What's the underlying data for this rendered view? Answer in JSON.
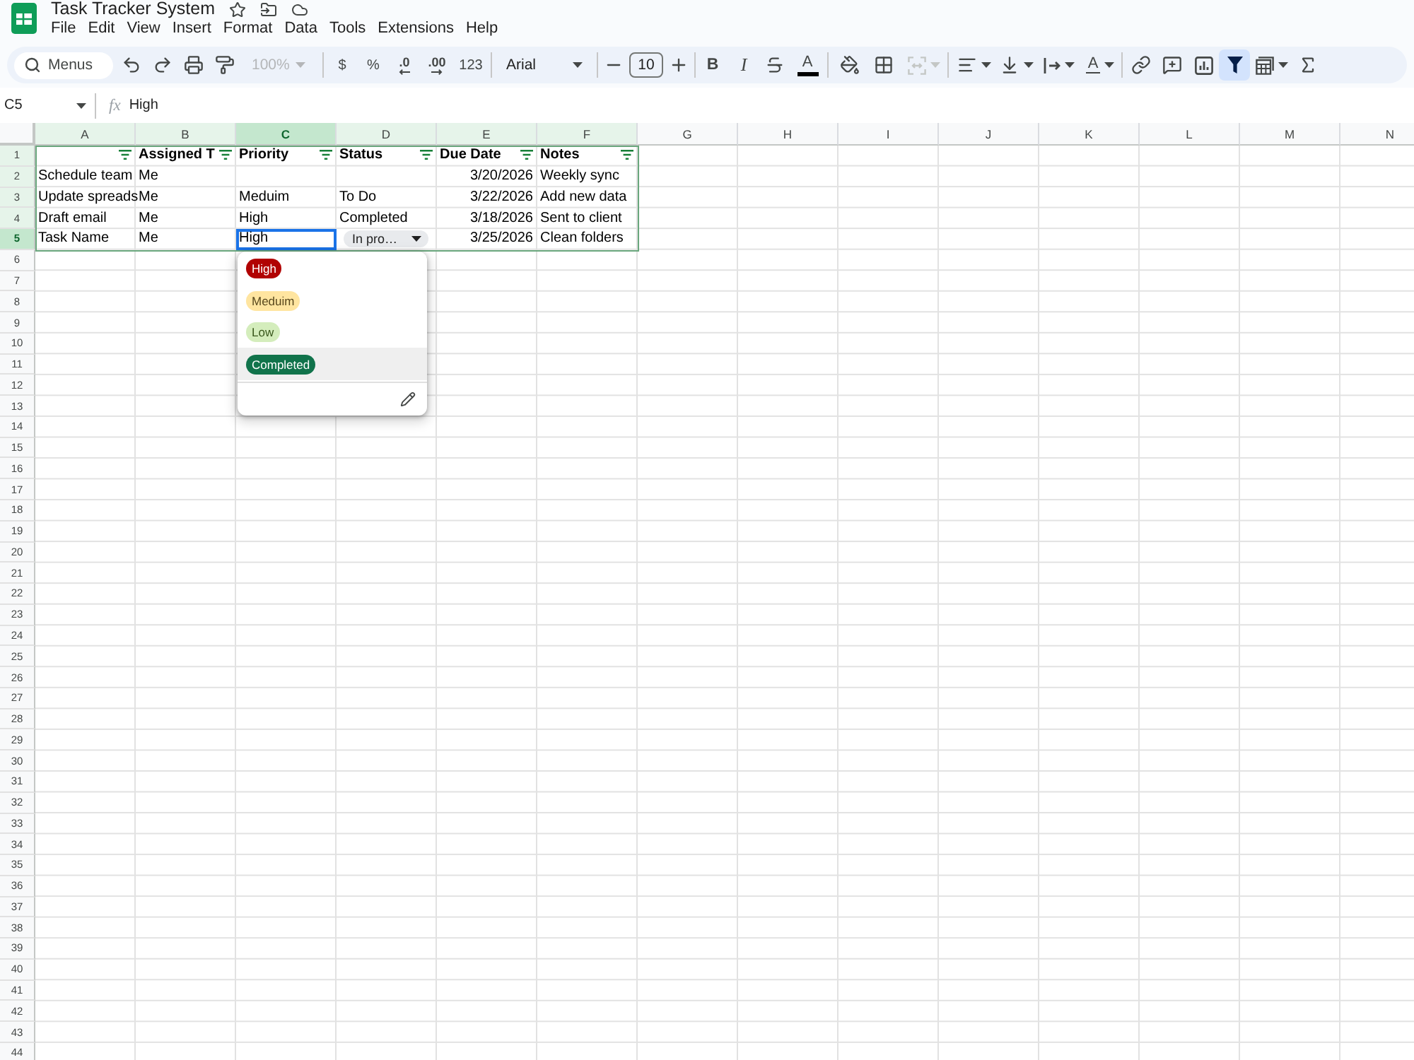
{
  "document": {
    "title": "Task Tracker System"
  },
  "menu_bar": [
    "File",
    "Edit",
    "View",
    "Insert",
    "Format",
    "Data",
    "Tools",
    "Extensions",
    "Help"
  ],
  "toolbar": {
    "search": {
      "placeholder": "Menus"
    },
    "zoom": {
      "value": "100%",
      "disabled": true
    },
    "currency": "$",
    "percent": "%",
    "decimal_decrease": ".0",
    "decimal_increase": ".00",
    "number_format": "123",
    "font": "Arial",
    "font_size": "10",
    "bold": "B",
    "italic": "I",
    "text_color": "A",
    "text_rotation": "A",
    "merge": {
      "disabled": true
    },
    "filter": {
      "active": true
    }
  },
  "formula_bar": {
    "name_box": "C5",
    "label": "fx",
    "value": "High"
  },
  "columns": [
    {
      "label": "A",
      "selected": false,
      "in_table": true
    },
    {
      "label": "B",
      "selected": false,
      "in_table": true
    },
    {
      "label": "C",
      "selected": true,
      "in_table": true
    },
    {
      "label": "D",
      "selected": false,
      "in_table": true
    },
    {
      "label": "E",
      "selected": false,
      "in_table": true
    },
    {
      "label": "F",
      "selected": false,
      "in_table": true
    },
    {
      "label": "G",
      "selected": false,
      "in_table": false
    },
    {
      "label": "H",
      "selected": false,
      "in_table": false
    },
    {
      "label": "I",
      "selected": false,
      "in_table": false
    },
    {
      "label": "J",
      "selected": false,
      "in_table": false
    },
    {
      "label": "K",
      "selected": false,
      "in_table": false
    },
    {
      "label": "L",
      "selected": false,
      "in_table": false
    },
    {
      "label": "M",
      "selected": false,
      "in_table": false
    },
    {
      "label": "N",
      "selected": false,
      "in_table": false
    }
  ],
  "rows": [
    {
      "number": "1",
      "selected": false,
      "in_table": true,
      "cells": [
        {
          "kind": "header",
          "filter": true,
          "selected": false
        },
        {
          "kind": "header",
          "text": "Assigned T",
          "filter": true,
          "selected": false
        },
        {
          "kind": "header",
          "text": "Priority",
          "filter": true,
          "selected": false
        },
        {
          "kind": "header",
          "text": "Status",
          "filter": true,
          "selected": false
        },
        {
          "kind": "header",
          "text": "Due Date",
          "filter": true,
          "selected": false
        },
        {
          "kind": "header",
          "text": "Notes",
          "filter": true,
          "selected": false
        }
      ]
    },
    {
      "number": "2",
      "selected": false,
      "in_table": true,
      "cells": [
        {
          "kind": "text",
          "text": "Schedule team",
          "selected": false
        },
        {
          "kind": "text",
          "text": "Me",
          "selected": false
        },
        null,
        null,
        {
          "kind": "number",
          "text": "3/20/2026",
          "selected": false
        },
        {
          "kind": "text",
          "text": "Weekly sync",
          "selected": false
        }
      ]
    },
    {
      "number": "3",
      "selected": false,
      "in_table": true,
      "cells": [
        {
          "kind": "text",
          "text": "Update spreads",
          "selected": false
        },
        {
          "kind": "text",
          "text": "Me",
          "selected": false
        },
        {
          "kind": "text",
          "text": "Meduim",
          "selected": false
        },
        {
          "kind": "text",
          "text": "To Do",
          "selected": false
        },
        {
          "kind": "number",
          "text": "3/22/2026",
          "selected": false
        },
        {
          "kind": "text",
          "text": "Add new data",
          "selected": false
        }
      ]
    },
    {
      "number": "4",
      "selected": false,
      "in_table": true,
      "cells": [
        {
          "kind": "text",
          "text": "Draft email",
          "selected": false
        },
        {
          "kind": "text",
          "text": "Me",
          "selected": false
        },
        {
          "kind": "text",
          "text": "High",
          "selected": false
        },
        {
          "kind": "text",
          "text": "Completed",
          "selected": false
        },
        {
          "kind": "number",
          "text": "3/18/2026",
          "selected": false
        },
        {
          "kind": "text",
          "text": "Sent to client",
          "selected": false
        }
      ]
    },
    {
      "number": "5",
      "selected": true,
      "in_table": true,
      "cells": [
        {
          "kind": "text",
          "text": "Task Name",
          "selected": false
        },
        {
          "kind": "text",
          "text": "Me",
          "selected": false
        },
        {
          "kind": "text",
          "text": "High",
          "selected": true
        },
        {
          "kind": "chip",
          "text": "In pro…",
          "selected": false
        },
        {
          "kind": "number",
          "text": "3/25/2026",
          "selected": false
        },
        {
          "kind": "text",
          "text": "Clean folders",
          "selected": false
        }
      ]
    },
    {
      "number": "6",
      "selected": false,
      "in_table": false
    },
    {
      "number": "7",
      "selected": false,
      "in_table": false
    },
    {
      "number": "8",
      "selected": false,
      "in_table": false
    },
    {
      "number": "9",
      "selected": false,
      "in_table": false
    },
    {
      "number": "10",
      "selected": false,
      "in_table": false
    },
    {
      "number": "11",
      "selected": false,
      "in_table": false
    },
    {
      "number": "12",
      "selected": false,
      "in_table": false
    },
    {
      "number": "13",
      "selected": false,
      "in_table": false
    },
    {
      "number": "14",
      "selected": false,
      "in_table": false
    },
    {
      "number": "15",
      "selected": false,
      "in_table": false
    },
    {
      "number": "16",
      "selected": false,
      "in_table": false
    },
    {
      "number": "17",
      "selected": false,
      "in_table": false
    },
    {
      "number": "18",
      "selected": false,
      "in_table": false
    },
    {
      "number": "19",
      "selected": false,
      "in_table": false
    },
    {
      "number": "20",
      "selected": false,
      "in_table": false
    },
    {
      "number": "21",
      "selected": false,
      "in_table": false
    },
    {
      "number": "22",
      "selected": false,
      "in_table": false
    },
    {
      "number": "23",
      "selected": false,
      "in_table": false
    },
    {
      "number": "24",
      "selected": false,
      "in_table": false
    },
    {
      "number": "25",
      "selected": false,
      "in_table": false
    },
    {
      "number": "26",
      "selected": false,
      "in_table": false
    },
    {
      "number": "27",
      "selected": false,
      "in_table": false
    },
    {
      "number": "28",
      "selected": false,
      "in_table": false
    },
    {
      "number": "29",
      "selected": false,
      "in_table": false
    },
    {
      "number": "30",
      "selected": false,
      "in_table": false
    },
    {
      "number": "31",
      "selected": false,
      "in_table": false
    },
    {
      "number": "32",
      "selected": false,
      "in_table": false
    },
    {
      "number": "33",
      "selected": false,
      "in_table": false
    },
    {
      "number": "34",
      "selected": false,
      "in_table": false
    },
    {
      "number": "35",
      "selected": false,
      "in_table": false
    },
    {
      "number": "36",
      "selected": false,
      "in_table": false
    },
    {
      "number": "37",
      "selected": false,
      "in_table": false
    },
    {
      "number": "38",
      "selected": false,
      "in_table": false
    },
    {
      "number": "39",
      "selected": false,
      "in_table": false
    },
    {
      "number": "40",
      "selected": false,
      "in_table": false
    },
    {
      "number": "41",
      "selected": false,
      "in_table": false
    },
    {
      "number": "42",
      "selected": false,
      "in_table": false
    },
    {
      "number": "43",
      "selected": false,
      "in_table": false
    },
    {
      "number": "44",
      "selected": false,
      "in_table": false
    }
  ],
  "dropdown": {
    "options": [
      {
        "label": "High",
        "color": "#b10202",
        "selected": false
      },
      {
        "label": "Meduim",
        "color": "#ffe5a0",
        "selected": false
      },
      {
        "label": "Low",
        "color": "#d4edbc",
        "selected": false
      },
      {
        "label": "Completed",
        "color": "#11734b",
        "selected": true
      }
    ]
  }
}
